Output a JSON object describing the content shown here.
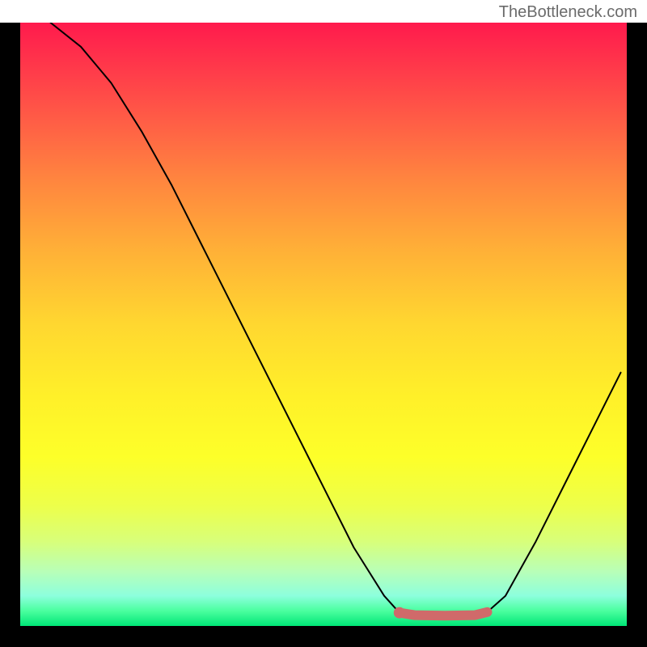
{
  "watermark": "TheBottleneck.com",
  "chart_data": {
    "type": "line",
    "title": "",
    "xlabel": "",
    "ylabel": "",
    "xlim": [
      0,
      100
    ],
    "ylim": [
      0,
      100
    ],
    "curve": {
      "x": [
        5,
        10,
        15,
        20,
        25,
        30,
        35,
        40,
        45,
        50,
        55,
        60,
        62.5,
        65,
        70,
        75,
        77,
        80,
        85,
        90,
        95,
        99
      ],
      "y": [
        100,
        96,
        90,
        82,
        73,
        63,
        53,
        43,
        33,
        23,
        13,
        5,
        2.2,
        1.8,
        1.7,
        1.8,
        2.3,
        5,
        14,
        24,
        34,
        42
      ]
    },
    "highlight": {
      "x": [
        62.5,
        65,
        70,
        75,
        77
      ],
      "y": [
        2.2,
        1.8,
        1.7,
        1.8,
        2.3
      ],
      "color": "#d06a6a"
    },
    "marker": {
      "x": 62.5,
      "y": 2.2,
      "color": "#d06a6a"
    },
    "background_gradient": {
      "stops": [
        "#ff1a4d",
        "#ffd730",
        "#00e676"
      ],
      "direction": "top-to-bottom"
    }
  }
}
